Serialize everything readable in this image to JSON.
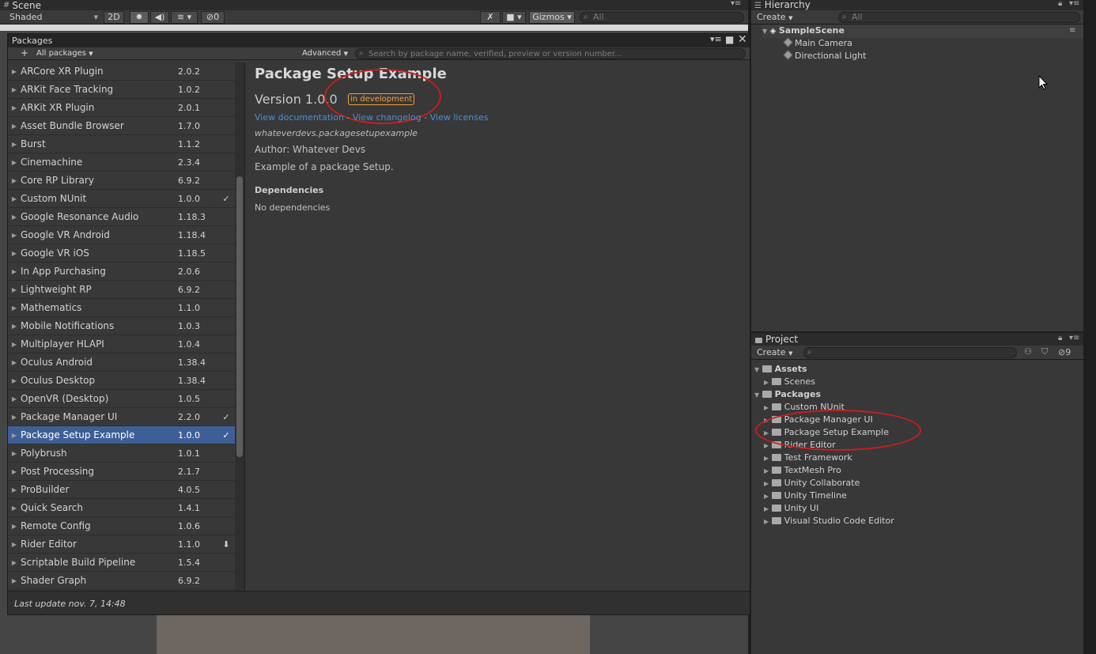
{
  "scene": {
    "tab_label": "Scene",
    "shading_mode": "Shaded",
    "mode_2d": "2D",
    "hidden_count": "0",
    "gizmos_label": "Gizmos",
    "search_placeholder": "All"
  },
  "packages_window": {
    "title": "Packages",
    "add_label": "+",
    "filter_label": "All packages",
    "advanced_label": "Advanced",
    "search_placeholder": "Search by package name, verified, preview or version number...",
    "list": [
      {
        "name": "ARCore XR Plugin",
        "version": "2.0.2",
        "status": ""
      },
      {
        "name": "ARKit Face Tracking",
        "version": "1.0.2",
        "status": ""
      },
      {
        "name": "ARKit XR Plugin",
        "version": "2.0.1",
        "status": ""
      },
      {
        "name": "Asset Bundle Browser",
        "version": "1.7.0",
        "status": ""
      },
      {
        "name": "Burst",
        "version": "1.1.2",
        "status": ""
      },
      {
        "name": "Cinemachine",
        "version": "2.3.4",
        "status": ""
      },
      {
        "name": "Core RP Library",
        "version": "6.9.2",
        "status": ""
      },
      {
        "name": "Custom NUnit",
        "version": "1.0.0",
        "status": "✓"
      },
      {
        "name": "Google Resonance Audio",
        "version": "1.18.3",
        "status": ""
      },
      {
        "name": "Google VR Android",
        "version": "1.18.4",
        "status": ""
      },
      {
        "name": "Google VR iOS",
        "version": "1.18.5",
        "status": ""
      },
      {
        "name": "In App Purchasing",
        "version": "2.0.6",
        "status": ""
      },
      {
        "name": "Lightweight RP",
        "version": "6.9.2",
        "status": ""
      },
      {
        "name": "Mathematics",
        "version": "1.1.0",
        "status": ""
      },
      {
        "name": "Mobile Notifications",
        "version": "1.0.3",
        "status": ""
      },
      {
        "name": "Multiplayer HLAPI",
        "version": "1.0.4",
        "status": ""
      },
      {
        "name": "Oculus Android",
        "version": "1.38.4",
        "status": ""
      },
      {
        "name": "Oculus Desktop",
        "version": "1.38.4",
        "status": ""
      },
      {
        "name": "OpenVR (Desktop)",
        "version": "1.0.5",
        "status": ""
      },
      {
        "name": "Package Manager UI",
        "version": "2.2.0",
        "status": "✓"
      },
      {
        "name": "Package Setup Example",
        "version": "1.0.0",
        "status": "✓"
      },
      {
        "name": "Polybrush",
        "version": "1.0.1",
        "status": ""
      },
      {
        "name": "Post Processing",
        "version": "2.1.7",
        "status": ""
      },
      {
        "name": "ProBuilder",
        "version": "4.0.5",
        "status": ""
      },
      {
        "name": "Quick Search",
        "version": "1.4.1",
        "status": ""
      },
      {
        "name": "Remote Config",
        "version": "1.0.6",
        "status": ""
      },
      {
        "name": "Rider Editor",
        "version": "1.1.0",
        "status": "⬇"
      },
      {
        "name": "Scriptable Build Pipeline",
        "version": "1.5.4",
        "status": ""
      },
      {
        "name": "Shader Graph",
        "version": "6.9.2",
        "status": ""
      }
    ],
    "selected_name": "Package Setup Example",
    "detail": {
      "title": "Package Setup Example",
      "version": "Version 1.0.0",
      "badge": "in development",
      "link_docs": "View documentation",
      "link_changelog": "View changelog",
      "link_licenses": "View licenses",
      "link_sep": "-",
      "package_id": "whateverdevs.packagesetupexample",
      "author": "Author: Whatever Devs",
      "description": "Example of a package Setup.",
      "dependencies_heading": "Dependencies",
      "dependencies_value": "No dependencies"
    },
    "footer": "Last update nov. 7, 14:48"
  },
  "hierarchy": {
    "tab_label": "Hierarchy",
    "create_label": "Create",
    "search_placeholder": "All",
    "scene_name": "SampleScene",
    "objects": [
      "Main Camera",
      "Directional Light"
    ]
  },
  "project": {
    "tab_label": "Project",
    "create_label": "Create",
    "hidden_count": "9",
    "assets_label": "Assets",
    "assets_children": [
      "Scenes"
    ],
    "packages_label": "Packages",
    "packages_children": [
      "Custom NUnit",
      "Package Manager UI",
      "Package Setup Example",
      "Rider Editor",
      "Test Framework",
      "TextMesh Pro",
      "Unity Collaborate",
      "Unity Timeline",
      "Unity UI",
      "Visual Studio Code Editor"
    ]
  },
  "colors": {
    "selection": "#3e5f96",
    "badge": "#f1a23c",
    "link": "#4c8fd9",
    "annotation_ring": "#c81e1e"
  },
  "icons": [
    "hash-icon",
    "lightbulb-icon",
    "speaker-icon",
    "layers-icon",
    "eye-hidden-icon",
    "tools-icon",
    "camera-icon",
    "search-icon",
    "menu-icon",
    "lock-icon",
    "maximize-icon",
    "close-icon",
    "unity-scene-icon",
    "gameobject-cube-icon",
    "folder-icon",
    "check-icon",
    "download-icon",
    "tag-icon",
    "cursor-icon"
  ]
}
